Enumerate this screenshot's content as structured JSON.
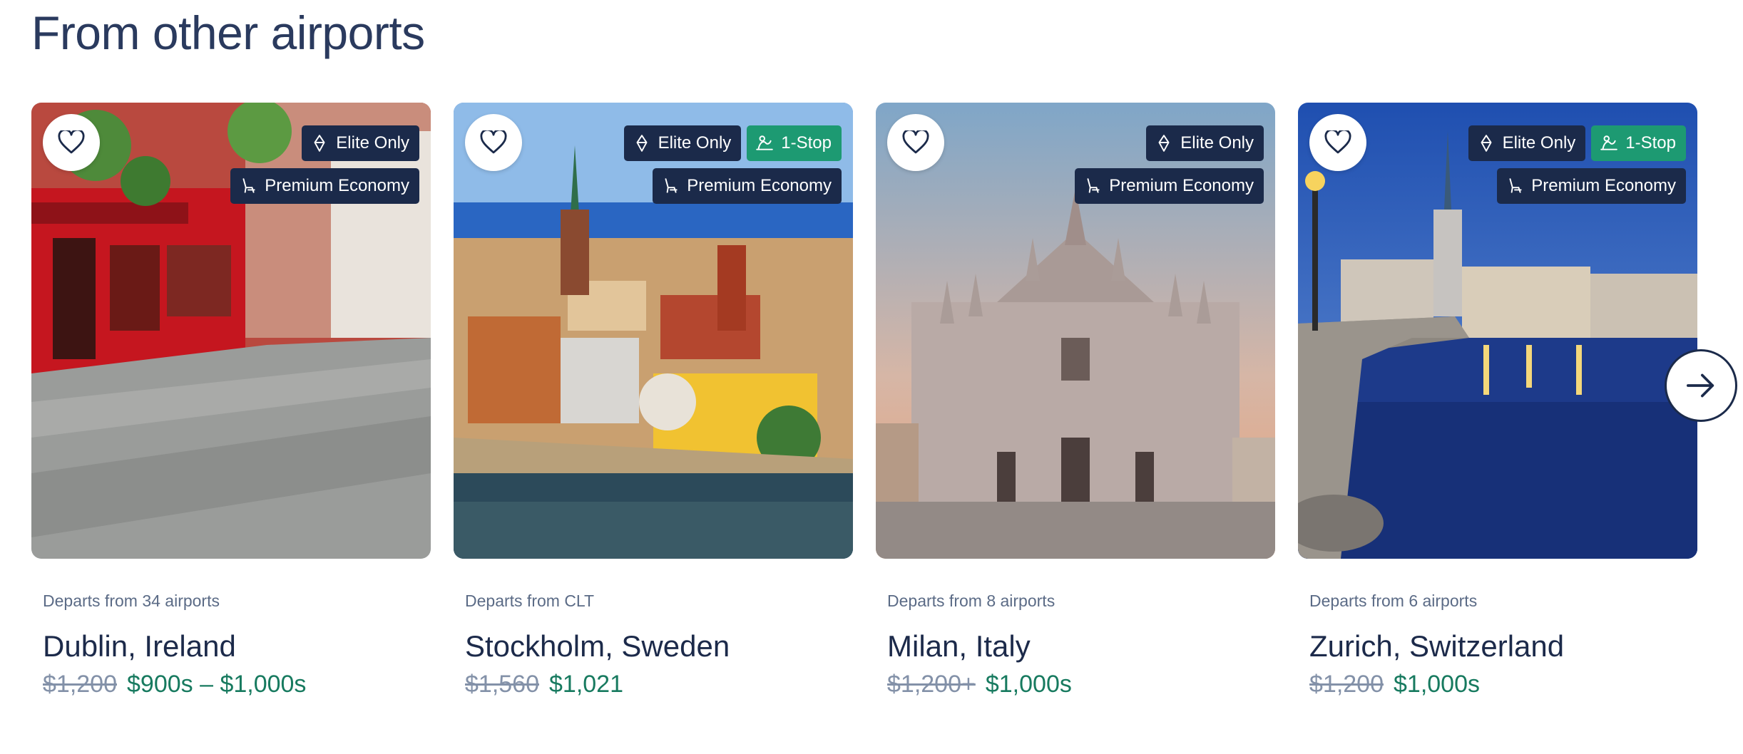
{
  "section": {
    "title": "From other airports"
  },
  "badges": {
    "elite": "Elite Only",
    "stop": "1-Stop",
    "cabin": "Premium Economy"
  },
  "cards": [
    {
      "departs": "Departs from 34 airports",
      "destination": "Dublin, Ireland",
      "old_price": "$1,200",
      "new_price": "$900s – $1,000s"
    },
    {
      "departs": "Departs from CLT",
      "destination": "Stockholm, Sweden",
      "old_price": "$1,560",
      "new_price": "$1,021"
    },
    {
      "departs": "Departs from 8 airports",
      "destination": "Milan, Italy",
      "old_price": "$1,200+",
      "new_price": "$1,000s"
    },
    {
      "departs": "Departs from 6 airports",
      "destination": "Zurich, Switzerland",
      "old_price": "$1,200",
      "new_price": "$1,000s"
    }
  ],
  "icons": {
    "favorite": "heart-icon",
    "elite": "diamond-icon",
    "stop": "route-icon",
    "cabin": "seat-icon",
    "next": "arrow-right-icon"
  },
  "colors": {
    "badge_dark": "#1b2a4a",
    "badge_green": "#1d9a72",
    "price_new": "#177a5f",
    "price_old": "#8391a8"
  }
}
